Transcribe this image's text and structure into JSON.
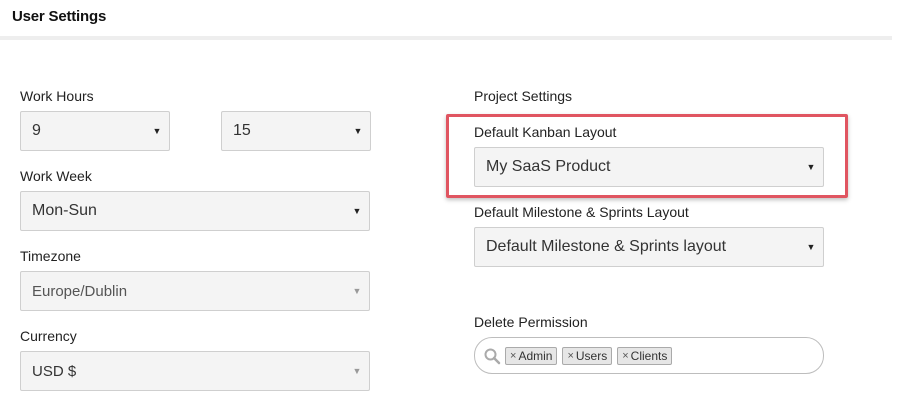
{
  "header": {
    "title": "User Settings"
  },
  "work_hours": {
    "label": "Work Hours",
    "start": "9",
    "end": "15"
  },
  "work_week": {
    "label": "Work Week",
    "value": "Mon-Sun"
  },
  "timezone": {
    "label": "Timezone",
    "value": "Europe/Dublin"
  },
  "currency": {
    "label": "Currency",
    "value": "USD $"
  },
  "project_settings": {
    "label": "Project Settings",
    "kanban": {
      "label": "Default Kanban Layout",
      "value": "My SaaS Product"
    },
    "milestone": {
      "label": "Default Milestone & Sprints Layout",
      "value": "Default Milestone & Sprints layout"
    },
    "delete_permission": {
      "label": "Delete Permission",
      "tags": [
        "Admin",
        "Users",
        "Clients"
      ]
    }
  },
  "icons": {
    "caret": "caret-down-icon",
    "search": "search-icon",
    "remove": "remove-tag-icon"
  },
  "colors": {
    "highlight": "#e05561",
    "select_bg": "#f4f4f4",
    "tag_bg": "#e6e6e6"
  }
}
